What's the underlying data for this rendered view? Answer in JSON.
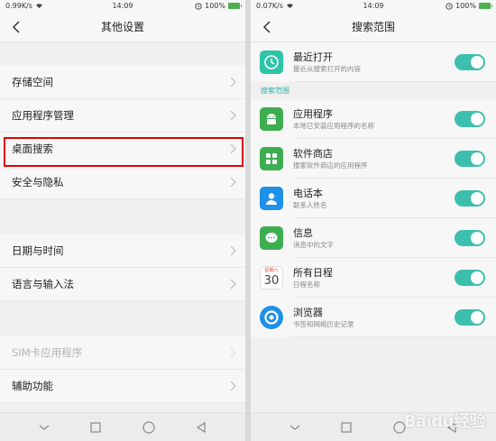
{
  "left": {
    "status": {
      "speed": "0.99K/s",
      "time": "14:09",
      "battery": "100%"
    },
    "title": "其他设置",
    "group1": [
      {
        "label": "存储空间"
      },
      {
        "label": "应用程序管理"
      },
      {
        "label": "桌面搜索"
      },
      {
        "label": "安全与隐私"
      }
    ],
    "group2": [
      {
        "label": "日期与时间"
      },
      {
        "label": "语言与输入法"
      }
    ],
    "group3": [
      {
        "label": "SIM卡应用程序"
      },
      {
        "label": "辅助功能"
      }
    ]
  },
  "right": {
    "status": {
      "speed": "0.07K/s",
      "time": "14:09",
      "battery": "100%"
    },
    "title": "搜索范围",
    "recent": {
      "title": "最近打开",
      "subtitle": "最近从搜索打开的内容",
      "enabled": true
    },
    "section_label": "搜索范围",
    "items": [
      {
        "title": "应用程序",
        "subtitle": "本地已安装应用程序的名称",
        "icon": "android-icon",
        "color": "#3dae50",
        "enabled": true
      },
      {
        "title": "软件商店",
        "subtitle": "搜索软件商店的应用程序",
        "icon": "app-store-icon",
        "color": "#3dae50",
        "enabled": true
      },
      {
        "title": "电话本",
        "subtitle": "联系人姓名",
        "icon": "contacts-icon",
        "color": "#1e90e8",
        "enabled": true
      },
      {
        "title": "信息",
        "subtitle": "消息中的文字",
        "icon": "message-icon",
        "color": "#3dae50",
        "enabled": true
      },
      {
        "title": "所有日程",
        "subtitle": "日程名称",
        "icon": "calendar-icon",
        "color": "#ffffff",
        "enabled": true
      },
      {
        "title": "浏览器",
        "subtitle": "书签和网络历史记录",
        "icon": "browser-icon",
        "color": "#1e90e8",
        "enabled": true
      }
    ],
    "calendar": {
      "weekday": "星期六",
      "day": "30"
    }
  },
  "colors": {
    "accent": "#3dbfae",
    "highlight": "#e10000",
    "clock_icon": "#2ec4a8"
  },
  "watermark": "Baidu经验"
}
